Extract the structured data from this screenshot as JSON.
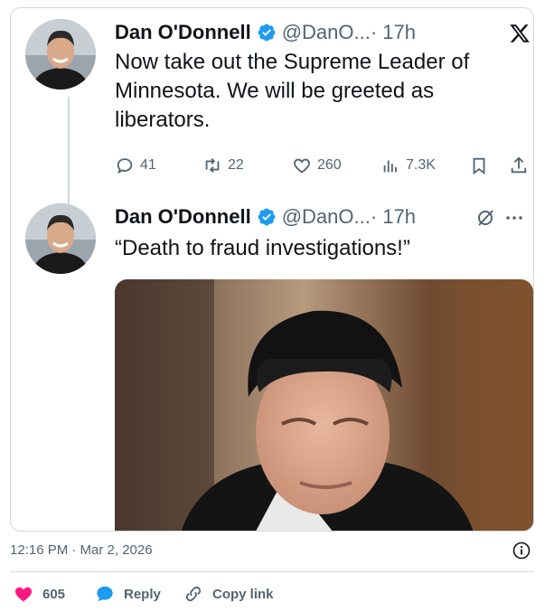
{
  "tweets": [
    {
      "author_name": "Dan O'Donnell",
      "handle": "@DanO...",
      "time": "· 17h",
      "text": "Now take out the Supreme Leader of Minnesota. We will be greeted as liberators.",
      "stats": {
        "replies": "41",
        "reposts": "22",
        "likes": "260",
        "views": "7.3K"
      }
    },
    {
      "author_name": "Dan O'Donnell",
      "handle": "@DanO...",
      "time": "· 17h",
      "text": "“Death to fraud investigations!”"
    }
  ],
  "footer": {
    "timestamp": "12:16 PM · Mar 2, 2026",
    "likes": "605",
    "reply_label": "Reply",
    "copy_link_label": "Copy link"
  },
  "colors": {
    "verified": "#1d9bf0",
    "heart": "#f91880",
    "reply_bubble": "#1d9bf0",
    "muted": "#536471"
  },
  "icons": [
    "x-logo-icon",
    "verified-badge-icon",
    "reply-icon",
    "repost-icon",
    "like-icon",
    "views-icon",
    "bookmark-icon",
    "share-icon",
    "grok-icon",
    "more-icon",
    "info-icon",
    "heart-icon",
    "speech-bubble-icon",
    "link-icon"
  ]
}
